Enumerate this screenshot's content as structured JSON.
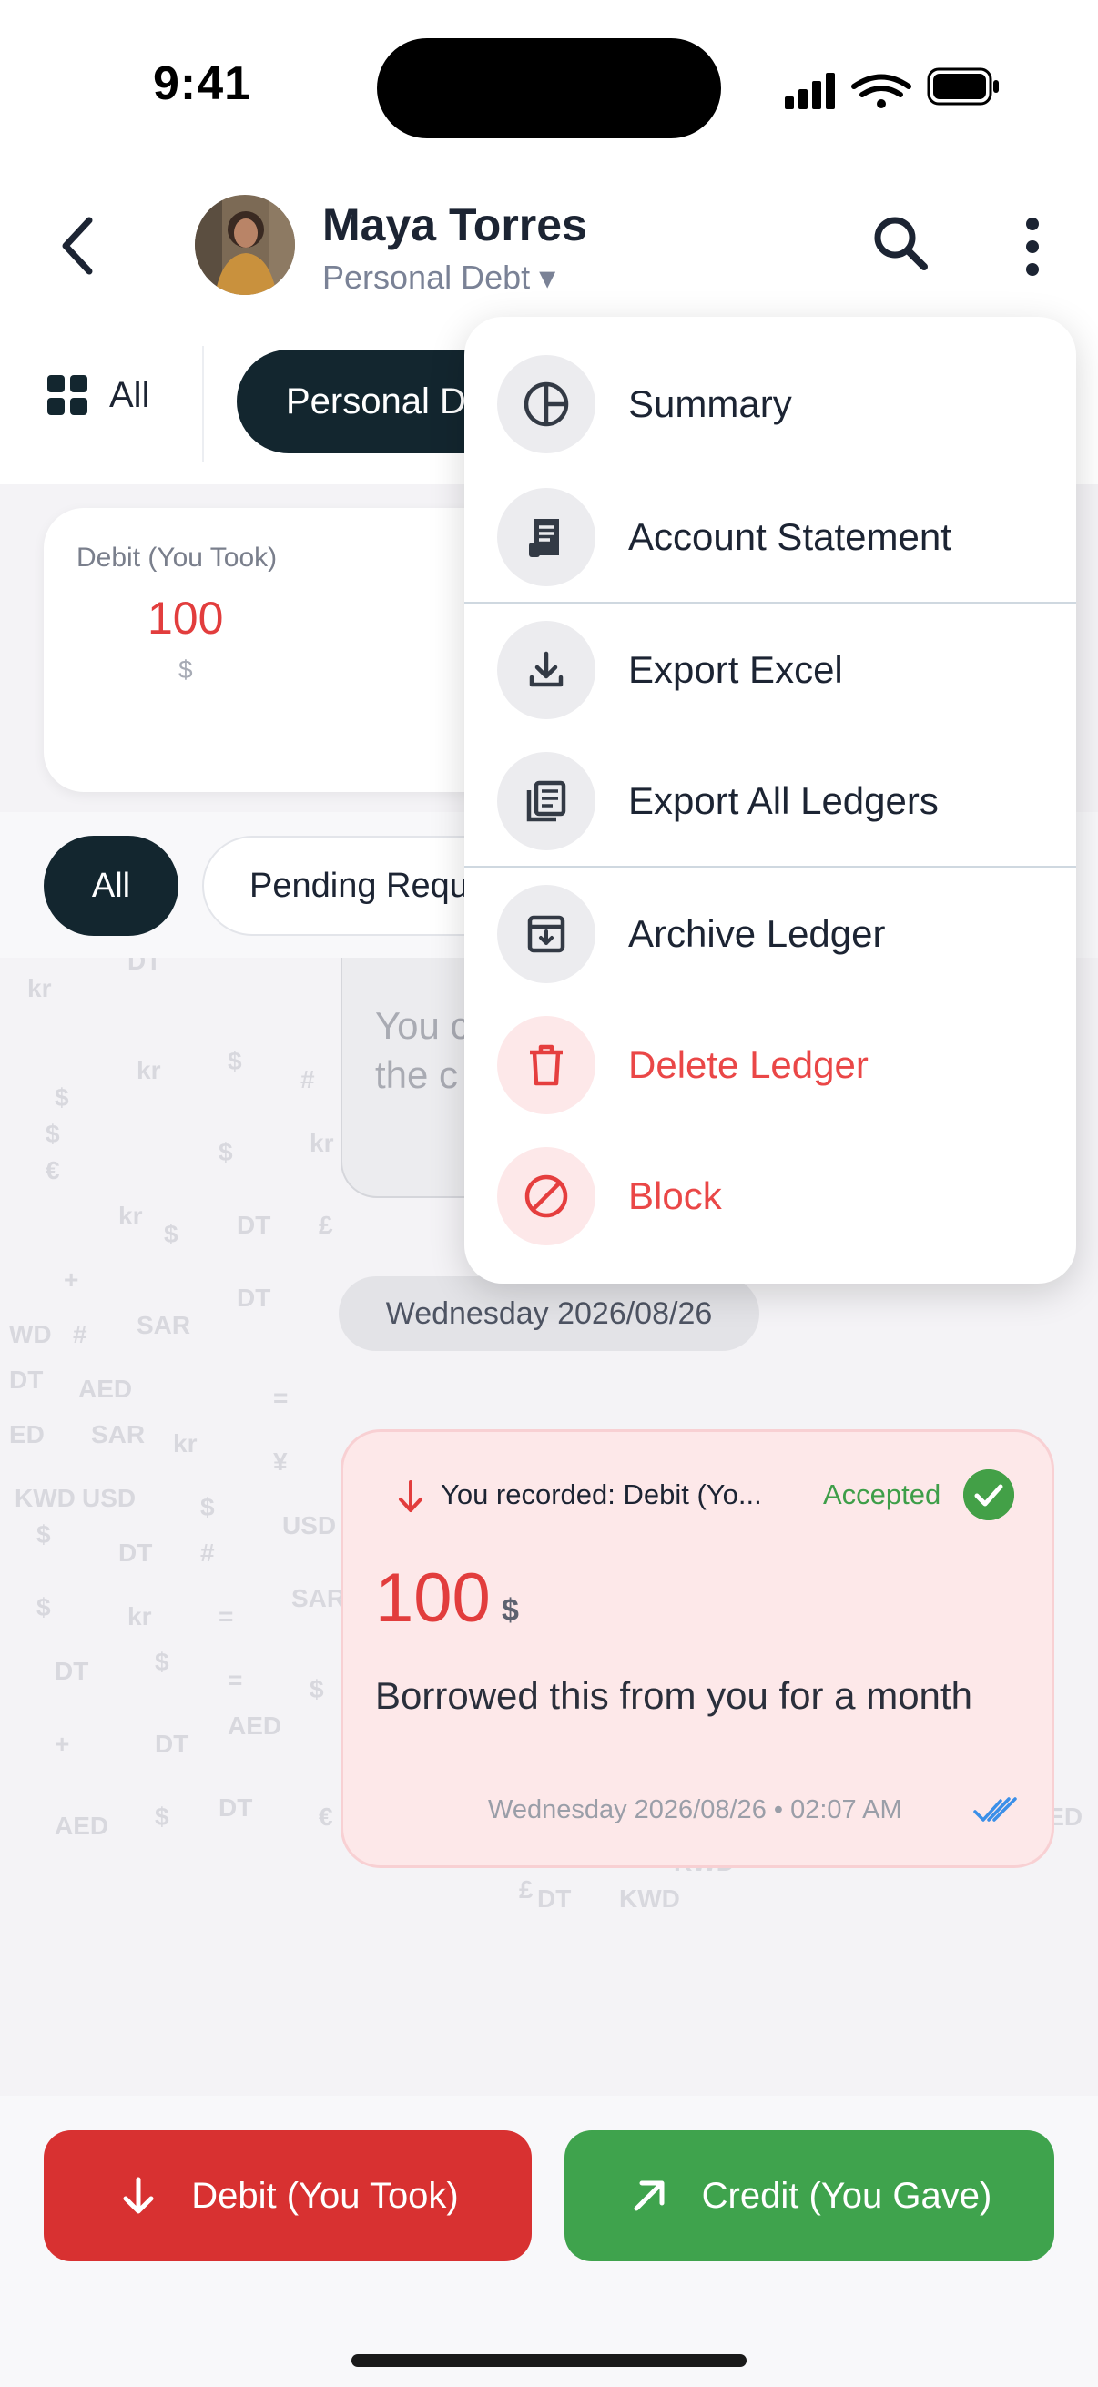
{
  "status_bar": {
    "time": "9:41"
  },
  "header": {
    "contact_name": "Maya Torres",
    "ledger_type": "Personal Debt ▾"
  },
  "tabs": {
    "all_label": "All",
    "active_label": "Personal Debt"
  },
  "summary": {
    "debit_label": "Debit (You Took)",
    "debit_value": "100",
    "debit_currency": "$"
  },
  "filters": {
    "all_label": "All",
    "pending_label": "Pending Requests"
  },
  "previous_message": {
    "text": "You c\nthe c"
  },
  "date_separator": "Wednesday 2026/08/26",
  "transaction": {
    "title": "You recorded: Debit (Yo...",
    "status": "Accepted",
    "amount": "100",
    "currency": "$",
    "note": "Borrowed this from you for a month",
    "timestamp": "Wednesday 2026/08/26 • 02:07 AM"
  },
  "actions": {
    "debit_label": "Debit (You Took)",
    "credit_label": "Credit (You Gave)"
  },
  "menu": {
    "summary": "Summary",
    "account_statement": "Account Statement",
    "export_excel": "Export Excel",
    "export_all": "Export All Ledgers",
    "archive": "Archive Ledger",
    "delete": "Delete Ledger",
    "block": "Block"
  },
  "colors": {
    "primary_dark": "#13262f",
    "debit_red": "#d83131",
    "credit_green": "#3fa34d",
    "danger": "#ea4747"
  },
  "background_symbols": [
    "$",
    "kr",
    "DT",
    "SAR",
    "AED",
    "KWD",
    "USD",
    "€",
    "£",
    "¥",
    "#",
    "+",
    "="
  ]
}
